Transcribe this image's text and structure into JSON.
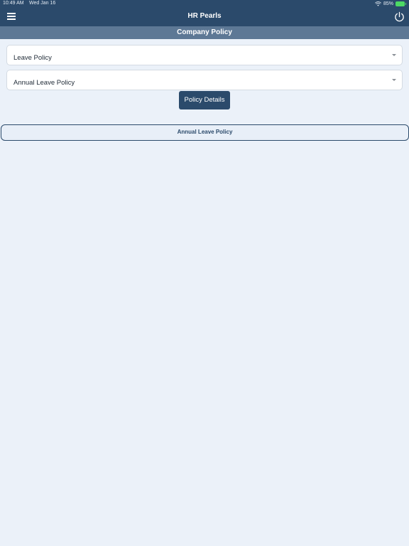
{
  "status_bar": {
    "time": "10:49 AM",
    "date": "Wed Jan 16",
    "battery": "85%"
  },
  "nav": {
    "title": "HR Pearls",
    "menu_icon": "hamburger-menu-icon",
    "power_icon": "power-icon"
  },
  "section": {
    "title": "Company Policy"
  },
  "dropdowns": [
    {
      "value": "Leave Policy"
    },
    {
      "value": "Annual Leave Policy"
    }
  ],
  "actions": {
    "details_label": "Policy Details"
  },
  "results": [
    {
      "label": "Annual Leave Policy"
    }
  ],
  "colors": {
    "primary": "#2b4a6b",
    "section_header": "#5d7895",
    "background": "#ebf1f9",
    "battery": "#4cd964"
  }
}
